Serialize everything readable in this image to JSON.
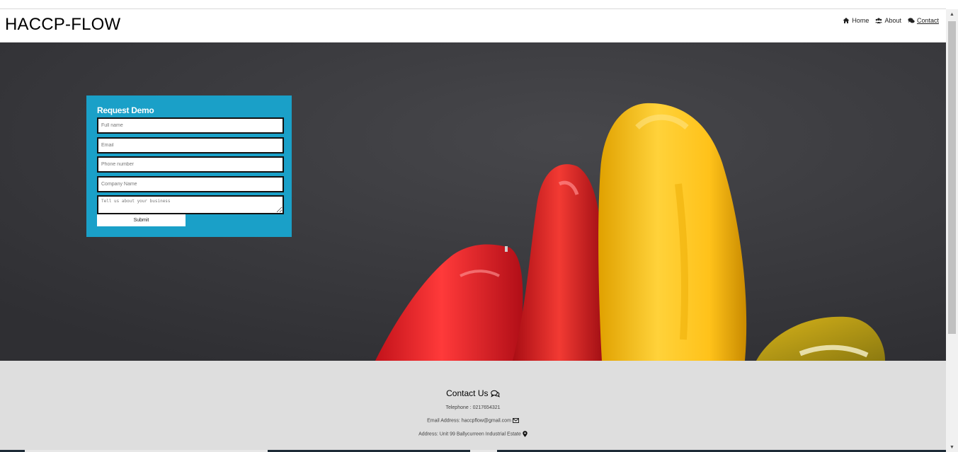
{
  "header": {
    "brand": "HACCP-FLOW",
    "nav": [
      {
        "label": "Home",
        "icon": "home-icon"
      },
      {
        "label": "About",
        "icon": "users-icon"
      },
      {
        "label": "Contact",
        "icon": "comments-icon",
        "active": true
      }
    ]
  },
  "form": {
    "title": "Request Demo",
    "fields": [
      {
        "placeholder": "Full name"
      },
      {
        "placeholder": "Email"
      },
      {
        "placeholder": "Phone number"
      },
      {
        "placeholder": "Company Name"
      }
    ],
    "message_placeholder": "Tell us about your business",
    "submit_label": "Submit"
  },
  "contact": {
    "title": "Contact Us",
    "telephone": "Telephone : 0217654321",
    "email": "Email Address: haccpflow@gmail.com",
    "address": "Address: Unit 99 Ballycurreen Industrial Estate"
  },
  "colors": {
    "form_bg": "#1aa0c8",
    "hero_bg": "#3a3a3e",
    "footer_bg": "#dedede",
    "top_text": "#e03a1e"
  },
  "icons": {
    "title_icon": "comments-icon",
    "email_icon": "envelope-icon",
    "address_icon": "map-marker-icon",
    "scroll_up": "chevron-up-icon",
    "scroll_down": "chevron-down-icon"
  }
}
